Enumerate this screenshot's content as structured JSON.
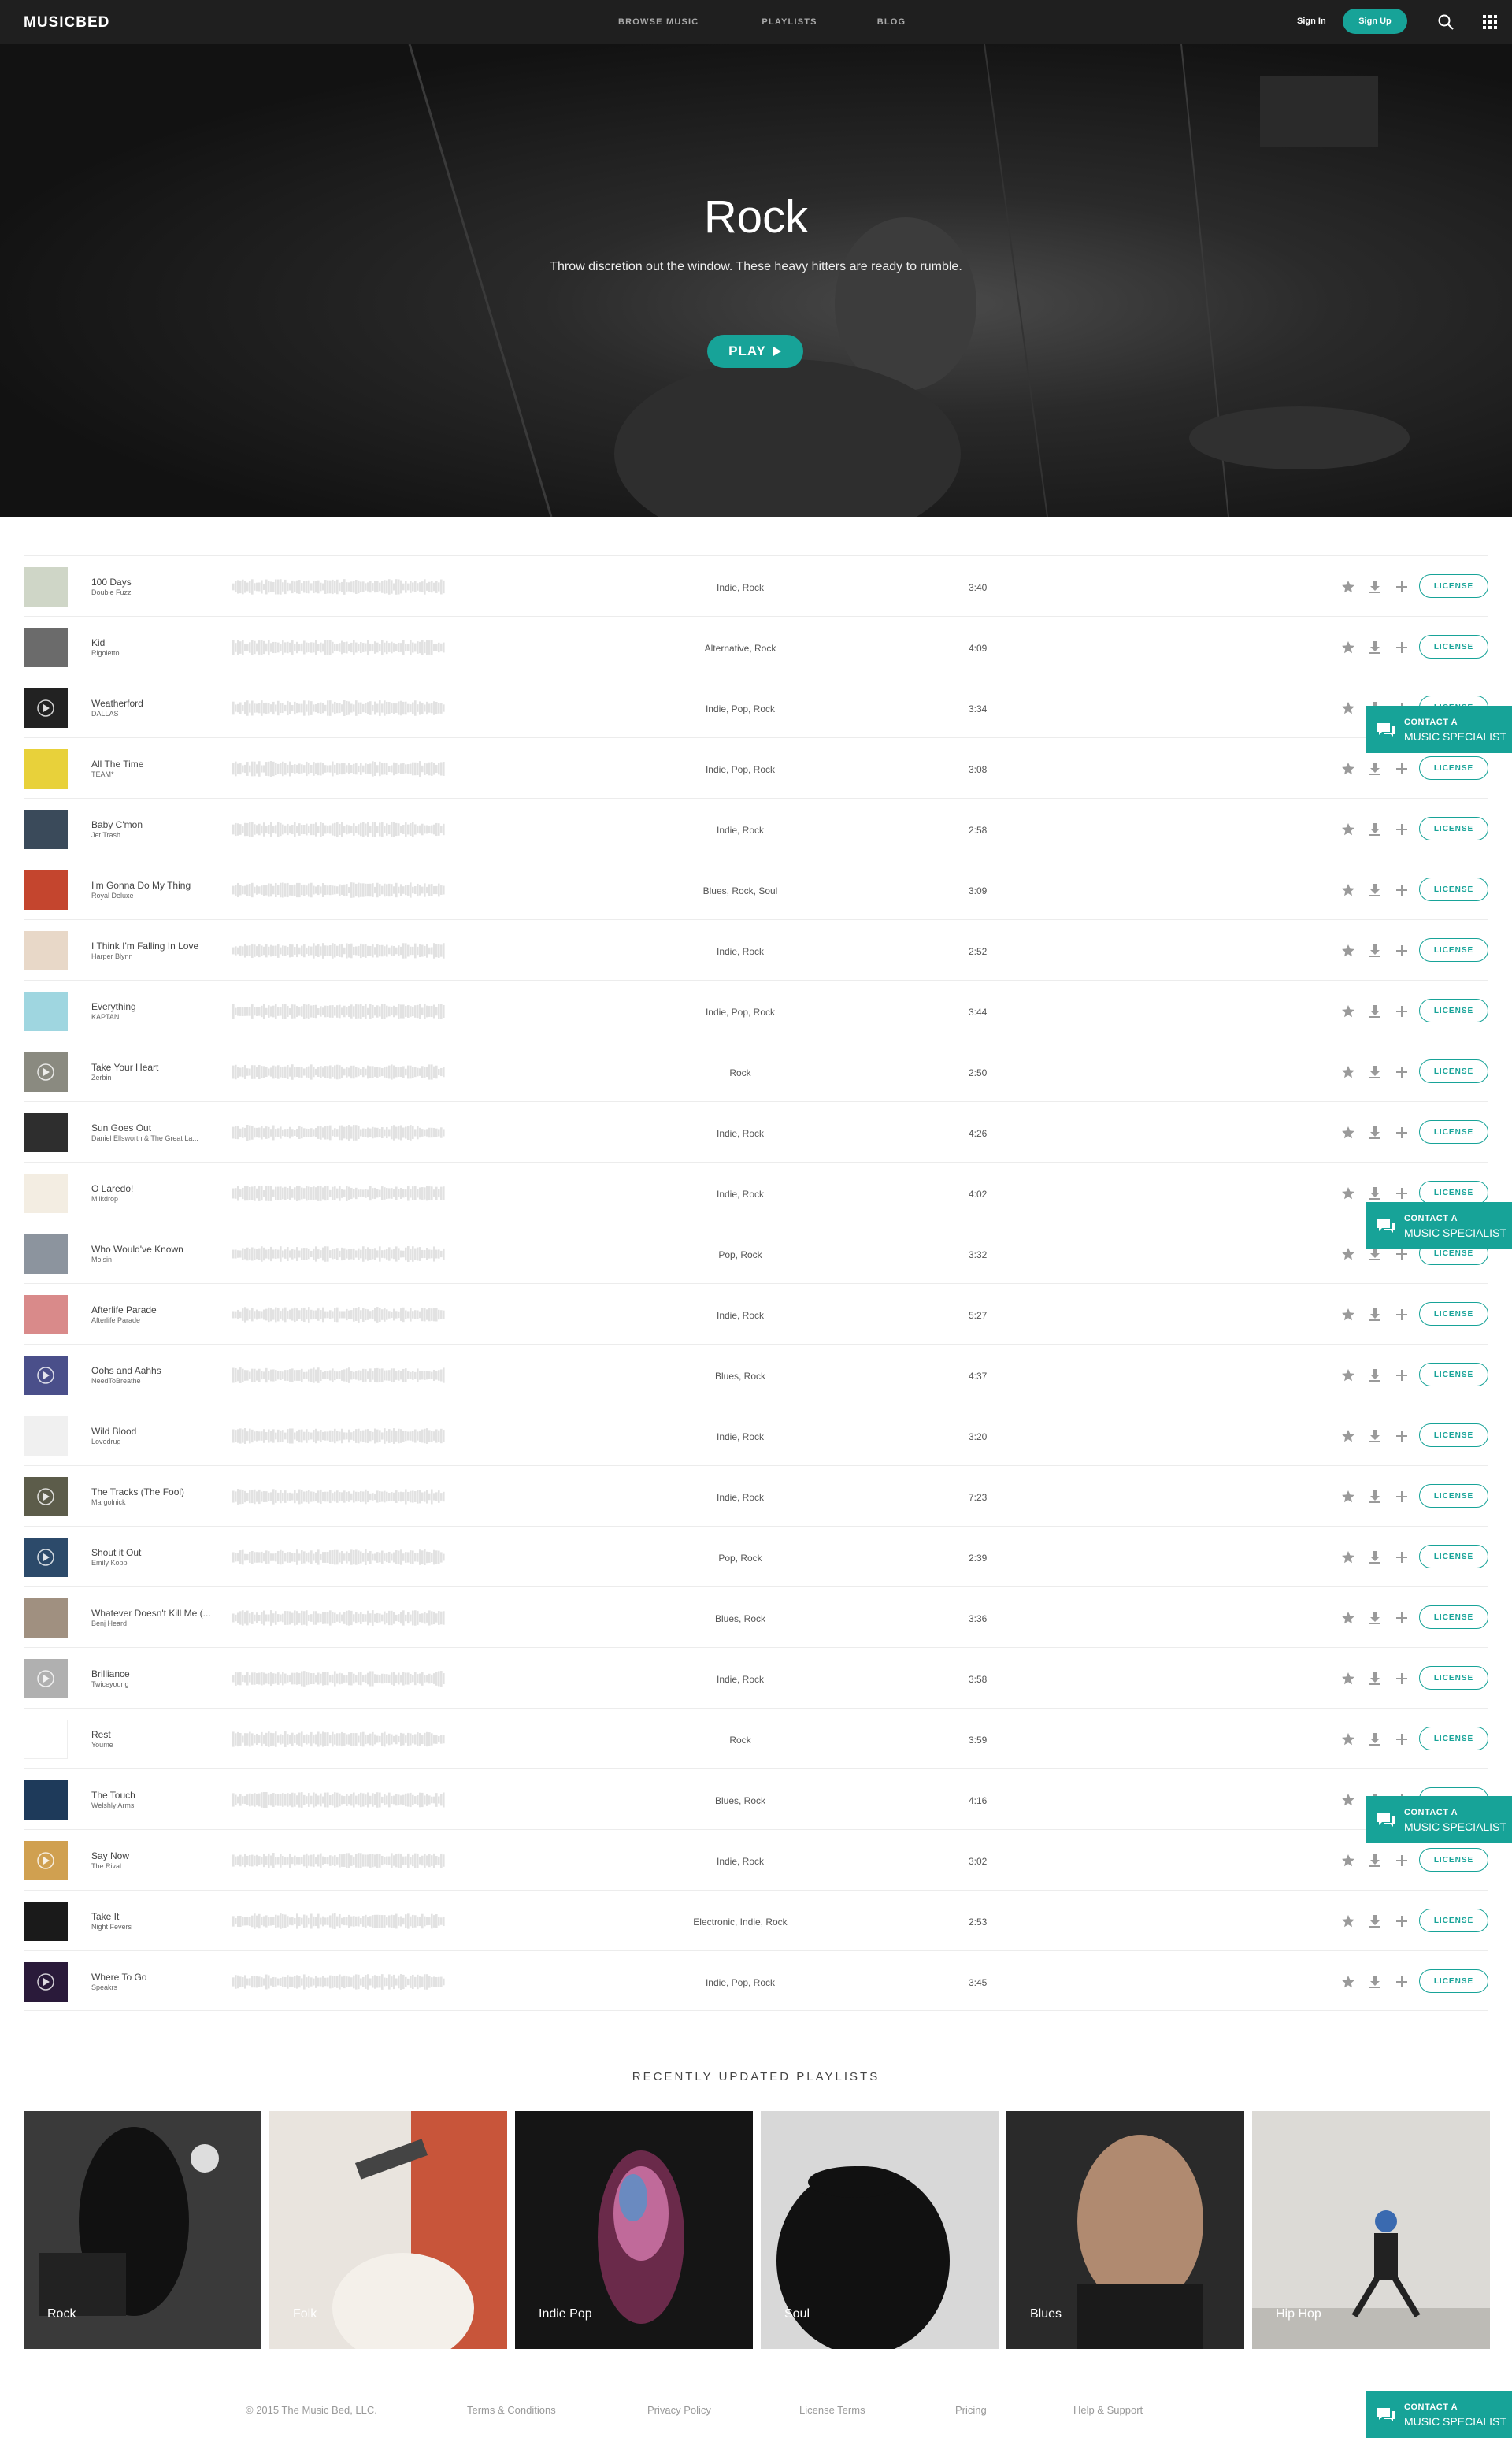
{
  "nav": {
    "logo": "MUSICBED",
    "links": [
      "BROWSE MUSIC",
      "PLAYLISTS",
      "BLOG"
    ],
    "signin": "Sign In",
    "signup": "Sign Up"
  },
  "hero": {
    "title": "Rock",
    "subtitle": "Throw discretion out the window. These heavy hitters are ready to rumble.",
    "play_label": "PLAY"
  },
  "tracks": [
    {
      "title": "100 Days",
      "artist": "Double Fuzz",
      "genres": "Indie, Rock",
      "duration": "3:40",
      "art": "#cfd6c7"
    },
    {
      "title": "Kid",
      "artist": "Rigoletto",
      "genres": "Alternative, Rock",
      "duration": "4:09",
      "art": "#6b6b6b"
    },
    {
      "title": "Weatherford",
      "artist": "DALLAS",
      "genres": "Indie, Pop, Rock",
      "duration": "3:34",
      "art": "#222222"
    },
    {
      "title": "All The Time",
      "artist": "TEAM*",
      "genres": "Indie, Pop, Rock",
      "duration": "3:08",
      "art": "#e8d13a"
    },
    {
      "title": "Baby C'mon",
      "artist": "Jet Trash",
      "genres": "Indie, Rock",
      "duration": "2:58",
      "art": "#3a4a5a"
    },
    {
      "title": "I'm Gonna Do My Thing",
      "artist": "Royal Deluxe",
      "genres": "Blues, Rock, Soul",
      "duration": "3:09",
      "art": "#c4452e"
    },
    {
      "title": "I Think I'm Falling In Love",
      "artist": "Harper Blynn",
      "genres": "Indie, Rock",
      "duration": "2:52",
      "art": "#e8d8c8"
    },
    {
      "title": "Everything",
      "artist": "KAPTAN",
      "genres": "Indie, Pop, Rock",
      "duration": "3:44",
      "art": "#9fd6e0"
    },
    {
      "title": "Take Your Heart",
      "artist": "Zerbin",
      "genres": "Rock",
      "duration": "2:50",
      "art": "#8a8a80"
    },
    {
      "title": "Sun Goes Out",
      "artist": "Daniel Ellsworth & The Great La...",
      "genres": "Indie, Rock",
      "duration": "4:26",
      "art": "#2e2e2e"
    },
    {
      "title": "O Laredo!",
      "artist": "Milkdrop",
      "genres": "Indie, Rock",
      "duration": "4:02",
      "art": "#f3ede2"
    },
    {
      "title": "Who Would've Known",
      "artist": "Moisin",
      "genres": "Pop, Rock",
      "duration": "3:32",
      "art": "#8c949e"
    },
    {
      "title": "Afterlife Parade",
      "artist": "Afterlife Parade",
      "genres": "Indie, Rock",
      "duration": "5:27",
      "art": "#d98a8a"
    },
    {
      "title": "Oohs and Aahhs",
      "artist": "NeedToBreathe",
      "genres": "Blues, Rock",
      "duration": "4:37",
      "art": "#4a4f8a"
    },
    {
      "title": "Wild Blood",
      "artist": "Lovedrug",
      "genres": "Indie, Rock",
      "duration": "3:20",
      "art": "#f0f0f0"
    },
    {
      "title": "The Tracks (The Fool)",
      "artist": "Margolnick",
      "genres": "Indie, Rock",
      "duration": "7:23",
      "art": "#5c5c4a"
    },
    {
      "title": "Shout it Out",
      "artist": "Emily Kopp",
      "genres": "Pop, Rock",
      "duration": "2:39",
      "art": "#2c4a6a"
    },
    {
      "title": "Whatever Doesn't Kill Me (...",
      "artist": "Benj Heard",
      "genres": "Blues, Rock",
      "duration": "3:36",
      "art": "#a09080"
    },
    {
      "title": "Brilliance",
      "artist": "Twiceyoung",
      "genres": "Indie, Rock",
      "duration": "3:58",
      "art": "#b0b0b0"
    },
    {
      "title": "Rest",
      "artist": "Youme",
      "genres": "Rock",
      "duration": "3:59",
      "art": "#ffffff"
    },
    {
      "title": "The Touch",
      "artist": "Welshly Arms",
      "genres": "Blues, Rock",
      "duration": "4:16",
      "art": "#1e3a5a"
    },
    {
      "title": "Say Now",
      "artist": "The Rival",
      "genres": "Indie, Rock",
      "duration": "3:02",
      "art": "#d0a050"
    },
    {
      "title": "Take It",
      "artist": "Night Fevers",
      "genres": "Electronic, Indie, Rock",
      "duration": "2:53",
      "art": "#1a1a1a"
    },
    {
      "title": "Where To Go",
      "artist": "Speakrs",
      "genres": "Indie, Pop, Rock",
      "duration": "3:45",
      "art": "#2a1a3a"
    }
  ],
  "license_label": "LICENSE",
  "contact": {
    "line1": "CONTACT A",
    "line2": "MUSIC SPECIALIST"
  },
  "playlists_heading": "RECENTLY UPDATED PLAYLISTS",
  "playlists": [
    {
      "name": "Rock",
      "bg": "#3a3a3a"
    },
    {
      "name": "Folk",
      "bg": "#e9e4de"
    },
    {
      "name": "Indie Pop",
      "bg": "#151515"
    },
    {
      "name": "Soul",
      "bg": "#9a9a9a"
    },
    {
      "name": "Blues",
      "bg": "#2a2a2a"
    },
    {
      "name": "Hip Hop",
      "bg": "#dcdad6"
    }
  ],
  "footer": {
    "copyright": "© 2015 The Music Bed, LLC.",
    "links": [
      "Terms & Conditions",
      "Privacy Policy",
      "License Terms",
      "Pricing",
      "Help & Support"
    ]
  },
  "colors": {
    "accent": "#17a398",
    "nav_bg": "#1f1f1f"
  }
}
